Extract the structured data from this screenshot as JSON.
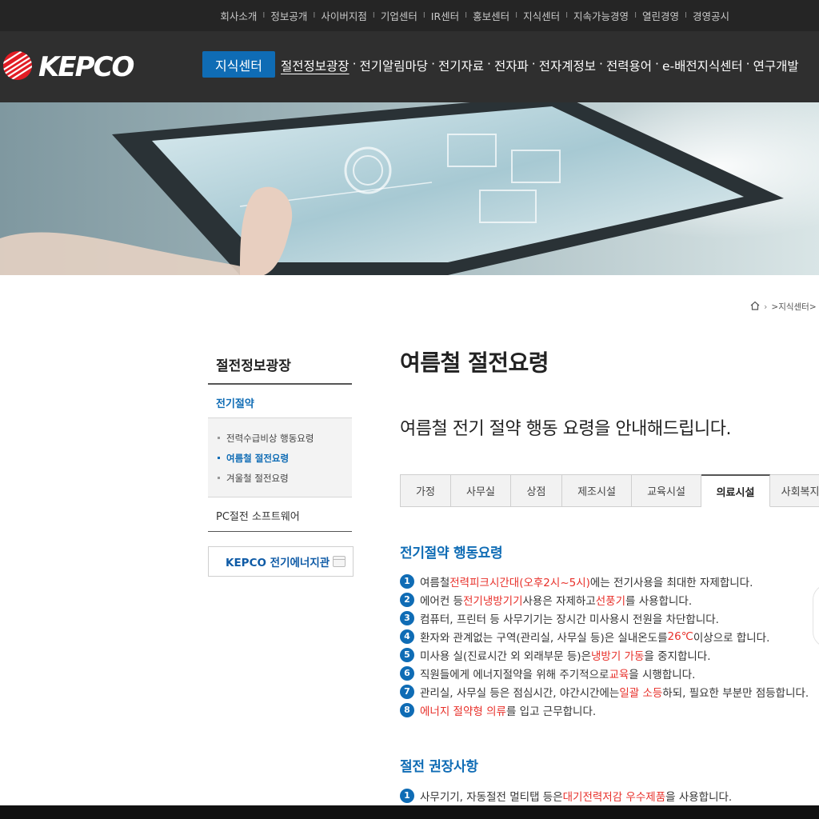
{
  "topbar": {
    "links": [
      "회사소개",
      "정보공개",
      "사이버지점",
      "기업센터",
      "IR센터",
      "홍보센터",
      "지식센터",
      "지속가능경영",
      "열린경영",
      "경영공시"
    ],
    "separator": "I"
  },
  "header": {
    "logo_text": "KEPCO",
    "badge": "지식센터",
    "menu": [
      "절전정보광장",
      "전기알림마당",
      "전기자료",
      "전자파",
      "전자계정보",
      "전력용어",
      "e-배전지식센터",
      "연구개발"
    ],
    "menu_separator": "·"
  },
  "breadcrumb": {
    "home_icon": "home-icon",
    "crumb": ">지식센터>"
  },
  "lnb": {
    "title": "절전정보광장",
    "current": "전기절약",
    "sub_items": [
      "전력수급비상 행동요령",
      "여름철 절전요령",
      "겨울철 절전요령"
    ],
    "active_sub": 1,
    "other": "PC절전 소프트웨어",
    "energy_button": "KEPCO 전기에너지관"
  },
  "content": {
    "title": "여름철 절전요령",
    "subtitle": "여름철 전기 절약 행동 요령을 안내해드립니다.",
    "tabs": [
      "가정",
      "사무실",
      "상점",
      "제조시설",
      "교육시설",
      "의료시설",
      "사회복지시설"
    ],
    "active_tab": 5,
    "section1": {
      "title": "전기절약 행동요령",
      "items": [
        {
          "num": "1",
          "parts": [
            {
              "t": "여름철 "
            },
            {
              "t": "전력피크시간대(오후2시~5시)",
              "hl": true
            },
            {
              "t": "에는 전기사용을 최대한 자제합니다."
            }
          ]
        },
        {
          "num": "2",
          "parts": [
            {
              "t": "에어컨 등 "
            },
            {
              "t": "전기냉방기기",
              "hl": true
            },
            {
              "t": " 사용은 자제하고 "
            },
            {
              "t": "선풍기",
              "hl": true
            },
            {
              "t": "를 사용합니다."
            }
          ]
        },
        {
          "num": "3",
          "parts": [
            {
              "t": "컴퓨터, 프린터 등 사무기기는 장시간 미사용시 전원을 차단합니다."
            }
          ]
        },
        {
          "num": "4",
          "parts": [
            {
              "t": "환자와 관계없는 구역(관리실, 사무실 등)은 실내온도를 "
            },
            {
              "t": "26℃",
              "hl": true
            },
            {
              "t": " 이상으로 합니다."
            }
          ]
        },
        {
          "num": "5",
          "parts": [
            {
              "t": "미사용 실(진료시간 외 외래부문 등)은 "
            },
            {
              "t": "냉방기 가동",
              "hl": true
            },
            {
              "t": "을 중지합니다."
            }
          ]
        },
        {
          "num": "6",
          "parts": [
            {
              "t": "직원들에게 에너지절약을 위해 주기적으로 "
            },
            {
              "t": "교육",
              "hl": true
            },
            {
              "t": "을 시행합니다."
            }
          ]
        },
        {
          "num": "7",
          "parts": [
            {
              "t": "관리실, 사무실 등은 점심시간, 야간시간에는 "
            },
            {
              "t": "일괄 소등",
              "hl": true
            },
            {
              "t": "하되, 필요한 부분만 점등합니다."
            }
          ]
        },
        {
          "num": "8",
          "parts": [
            {
              "t": "에너지 절약형 의류",
              "hl": true
            },
            {
              "t": "를 입고 근무합니다."
            }
          ]
        }
      ]
    },
    "section2": {
      "title": "절전 권장사항",
      "items": [
        {
          "num": "1",
          "parts": [
            {
              "t": "사무기기, 자동절전 멀티탭 등은 "
            },
            {
              "t": "대기전력저감 우수제품",
              "hl": true
            },
            {
              "t": "을 사용합니다."
            }
          ]
        }
      ]
    }
  },
  "colors": {
    "brand_blue": "#0f6cb5",
    "highlight_red": "#e8302a",
    "topbar_bg": "#252525",
    "header_bg": "#2f2f2f",
    "logo_red": "#e11d25"
  }
}
